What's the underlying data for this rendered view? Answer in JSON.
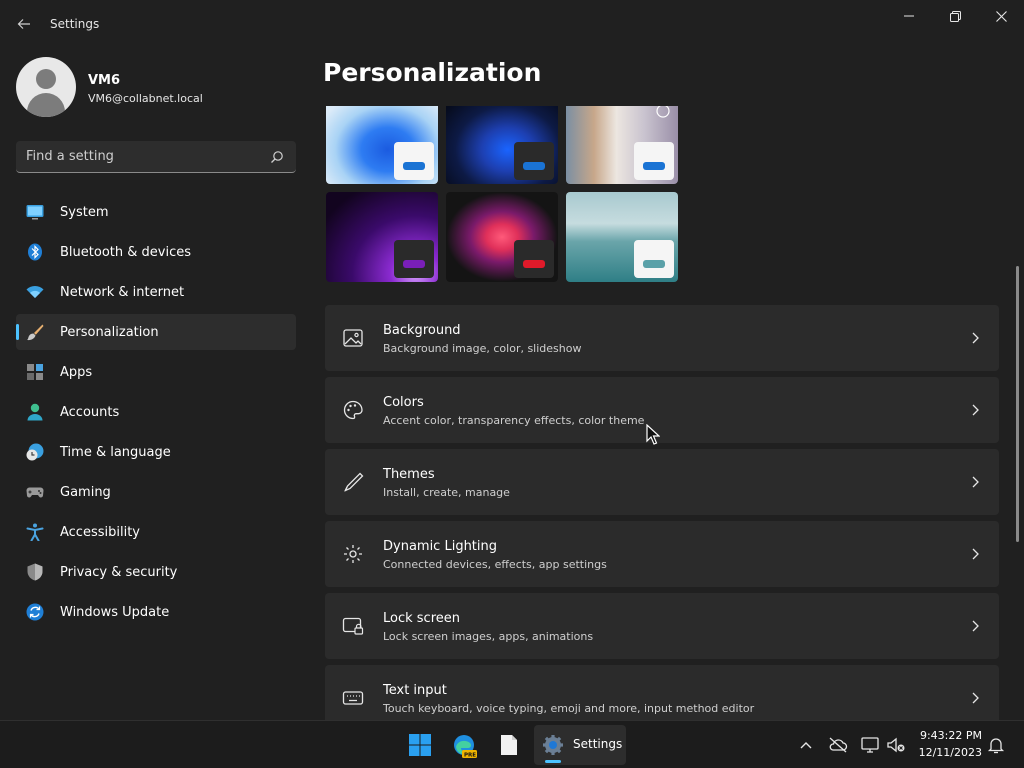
{
  "window": {
    "title": "Settings",
    "back_glyph": "←"
  },
  "profile": {
    "name": "VM6",
    "email": "VM6@collabnet.local"
  },
  "search": {
    "placeholder": "Find a setting"
  },
  "sidebar": {
    "items": [
      {
        "label": "System",
        "icon": "system-icon"
      },
      {
        "label": "Bluetooth & devices",
        "icon": "bluetooth-icon"
      },
      {
        "label": "Network & internet",
        "icon": "network-icon"
      },
      {
        "label": "Personalization",
        "icon": "brush-icon",
        "active": true
      },
      {
        "label": "Apps",
        "icon": "apps-icon"
      },
      {
        "label": "Accounts",
        "icon": "accounts-icon"
      },
      {
        "label": "Time & language",
        "icon": "time-icon"
      },
      {
        "label": "Gaming",
        "icon": "gaming-icon"
      },
      {
        "label": "Accessibility",
        "icon": "accessibility-icon"
      },
      {
        "label": "Privacy & security",
        "icon": "shield-icon"
      },
      {
        "label": "Windows Update",
        "icon": "update-icon"
      }
    ]
  },
  "main": {
    "title": "Personalization",
    "cards": [
      {
        "title": "Background",
        "subtitle": "Background image, color, slideshow",
        "icon": "image-icon"
      },
      {
        "title": "Colors",
        "subtitle": "Accent color, transparency effects, color theme",
        "icon": "palette-icon"
      },
      {
        "title": "Themes",
        "subtitle": "Install, create, manage",
        "icon": "pen-icon"
      },
      {
        "title": "Dynamic Lighting",
        "subtitle": "Connected devices, effects, app settings",
        "icon": "lighting-icon"
      },
      {
        "title": "Lock screen",
        "subtitle": "Lock screen images, apps, animations",
        "icon": "lock-screen-icon"
      },
      {
        "title": "Text input",
        "subtitle": "Touch keyboard, voice typing, emoji and more, input method editor",
        "icon": "keyboard-icon"
      }
    ]
  },
  "taskbar": {
    "settings_label": "Settings",
    "time": "9:43:22 PM",
    "date": "12/11/2023"
  },
  "colors": {
    "accent": "#4cc2ff",
    "background": "#202020",
    "card": "#2b2b2b"
  }
}
